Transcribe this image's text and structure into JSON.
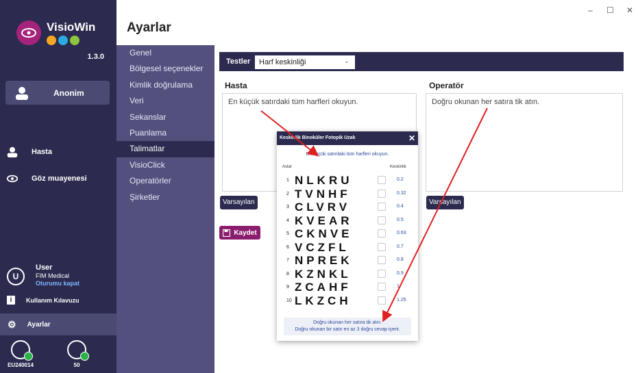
{
  "window": {
    "controls": [
      "–",
      "☐",
      "✕"
    ]
  },
  "sidebar": {
    "app_name": "VisioWin",
    "version": "1.3.0",
    "anon_label": "Anonim",
    "items": [
      {
        "label": "Hasta"
      },
      {
        "label": "Göz muayenesi"
      }
    ],
    "user": {
      "avatar": "U",
      "name": "User",
      "company": "FIM Medical",
      "logout": "Oturumu kapat"
    },
    "guide_label": "Kullanım Kılavuzu",
    "settings_label": "Ayarlar",
    "devices": [
      {
        "label": "EU240014"
      },
      {
        "label": "50"
      }
    ]
  },
  "page_title": "Ayarlar",
  "settings_menu": [
    "Genel",
    "Bölgesel seçenekler",
    "Kimlik doğrulama",
    "Veri",
    "Sekanslar",
    "Puanlama",
    "Talimatlar",
    "VisioClick",
    "Operatörler",
    "Şirketler"
  ],
  "tests": {
    "label": "Testler",
    "selected": "Harf keskinliği"
  },
  "hasta": {
    "label": "Hasta",
    "text": "En küçük satırdaki tüm harfleri okuyun.",
    "default_btn": "Varsayılan"
  },
  "operator": {
    "label": "Operatör",
    "text": "Doğru okunan her satıra tik atın.",
    "default_btn": "Varsayılan"
  },
  "save_label": "Kaydet",
  "popup": {
    "title": "Keskinlik Binoküler Fotopik Uzak",
    "close": "✕",
    "instruction": "En küçük satırdaki tüm harfleri okuyun.",
    "col_row": "Astar",
    "col_acuity": "Keskinlik",
    "rows": [
      {
        "n": "1",
        "letters": "NLKRU",
        "value": "0.2"
      },
      {
        "n": "2",
        "letters": "TVNHF",
        "value": "0.32"
      },
      {
        "n": "3",
        "letters": "CLVRV",
        "value": "0.4"
      },
      {
        "n": "4",
        "letters": "KVEAR",
        "value": "0.5"
      },
      {
        "n": "5",
        "letters": "CKNVE",
        "value": "0.63"
      },
      {
        "n": "6",
        "letters": "VCZFL",
        "value": "0.7"
      },
      {
        "n": "7",
        "letters": "NPREK",
        "value": "0.8"
      },
      {
        "n": "8",
        "letters": "KZNKL",
        "value": "0.9"
      },
      {
        "n": "9",
        "letters": "ZCAHF",
        "value": "1"
      },
      {
        "n": "10",
        "letters": "LKZCH",
        "value": "1.25"
      }
    ],
    "footer_line1": "Doğru okunan her satıra tik atın.",
    "footer_line2": "Doğru okunan bir satır en az 3 doğru cevap içerir."
  },
  "colors": {
    "sidebar": "#2c2b4f",
    "menu": "#53507e",
    "accent": "#8b1d6e",
    "arrow": "#e02020"
  }
}
